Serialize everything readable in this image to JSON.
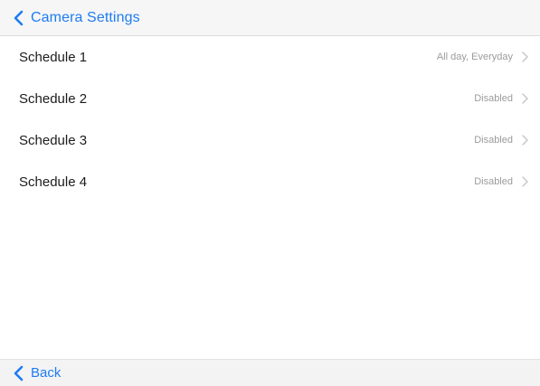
{
  "nav": {
    "back_title": "Camera Settings"
  },
  "schedules": [
    {
      "label": "Schedule 1",
      "status": "All day, Everyday"
    },
    {
      "label": "Schedule 2",
      "status": "Disabled"
    },
    {
      "label": "Schedule 3",
      "status": "Disabled"
    },
    {
      "label": "Schedule 4",
      "status": "Disabled"
    }
  ],
  "footer": {
    "back_label": "Back"
  },
  "colors": {
    "accent": "#1e7cf2",
    "secondary_text": "#9b9b9b",
    "bar_background": "#f6f6f7"
  },
  "icons": {
    "back": "chevron-left-icon",
    "disclosure": "chevron-right-icon"
  }
}
